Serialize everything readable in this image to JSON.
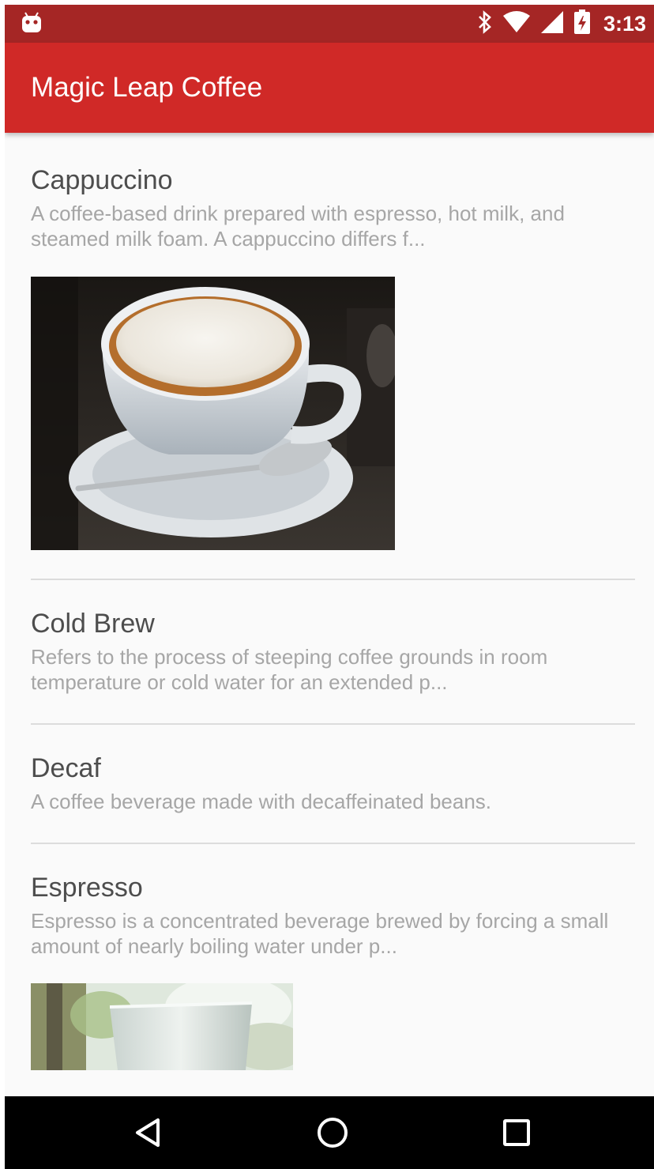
{
  "status_bar": {
    "time": "3:13",
    "icons": [
      "android-robot-icon",
      "bluetooth-icon",
      "wifi-icon",
      "cell-signal-icon",
      "battery-charging-icon"
    ],
    "background": "#a52625"
  },
  "app_bar": {
    "title": "Magic Leap Coffee",
    "background": "#d02927"
  },
  "coffees": [
    {
      "name": "Cappuccino",
      "description": "A coffee-based drink prepared with espresso, hot milk, and steamed milk foam. A cappuccino differs f...",
      "has_photo": true
    },
    {
      "name": "Cold Brew",
      "description": "Refers to the process of steeping coffee grounds in room temperature or cold water for an extended p...",
      "has_photo": false
    },
    {
      "name": "Decaf",
      "description": "A coffee beverage made with decaffeinated beans.",
      "has_photo": false
    },
    {
      "name": "Espresso",
      "description": "Espresso is a concentrated beverage brewed by forcing a small amount of nearly boiling water under p...",
      "has_photo": true
    }
  ],
  "nav_bar": {
    "buttons": [
      "back-triangle-icon",
      "home-circle-icon",
      "recents-square-icon"
    ]
  }
}
